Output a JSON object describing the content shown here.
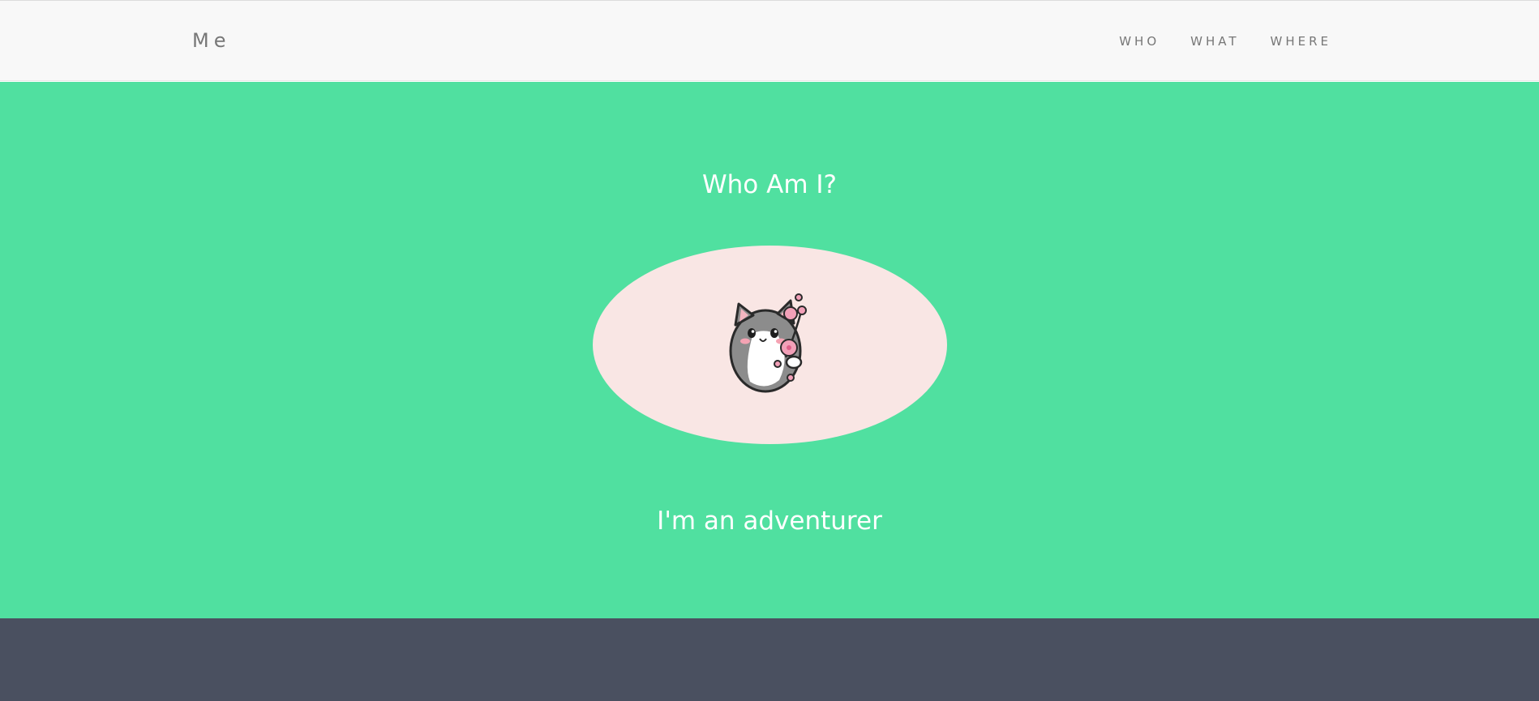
{
  "navbar": {
    "brand": "Me",
    "links": [
      "WHO",
      "WHAT",
      "WHERE"
    ]
  },
  "hero": {
    "title": "Who Am I?",
    "subtitle": "I'm an adventurer",
    "avatar_icon": "cat-with-flowers-icon"
  },
  "colors": {
    "navbar_bg": "#f8f8f8",
    "hero_bg": "#50e0a0",
    "avatar_bg": "#f9e6e4",
    "footer_bg": "#4a5060",
    "nav_text": "#777777",
    "hero_text": "#ffffff"
  }
}
